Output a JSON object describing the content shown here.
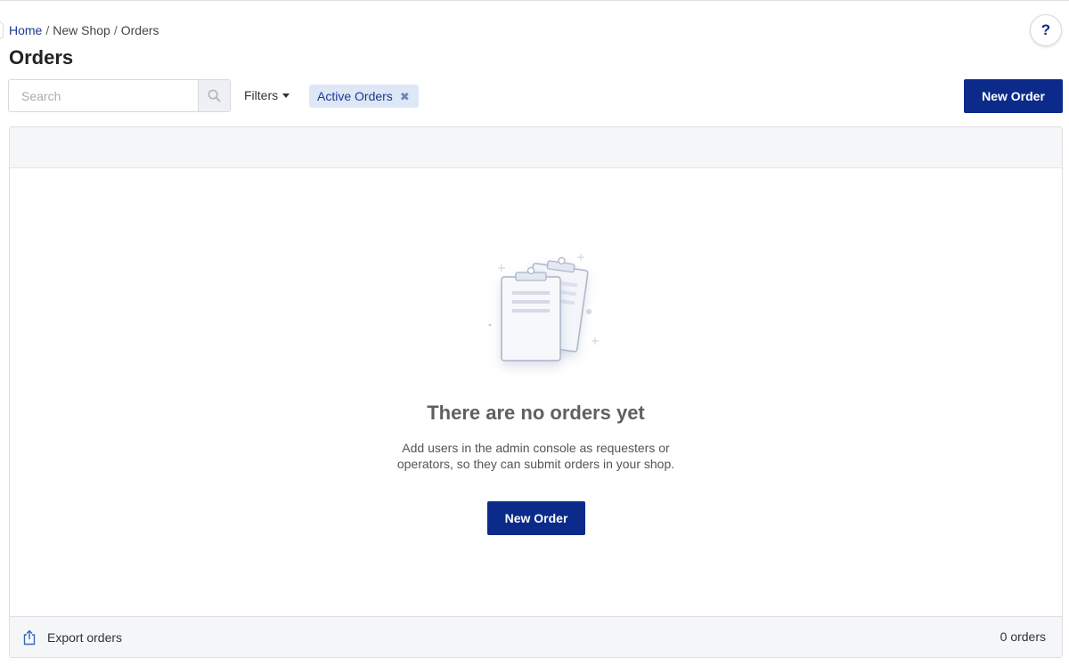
{
  "breadcrumb": {
    "items": [
      {
        "label": "Home"
      },
      {
        "label": "New Shop"
      },
      {
        "label": "Orders"
      }
    ],
    "separator": "/"
  },
  "help": {
    "label": "?"
  },
  "page": {
    "title": "Orders"
  },
  "toolbar": {
    "search_placeholder": "Search",
    "search_value": "",
    "filters_label": "Filters",
    "active_filter": "Active Orders",
    "new_order_label": "New Order"
  },
  "empty_state": {
    "title": "There are no orders yet",
    "description_line1": "Add users in the admin console as requesters or",
    "description_line2": "operators, so they can submit orders in your shop.",
    "button_label": "New Order"
  },
  "footer": {
    "export_label": "Export orders",
    "count_label": "0 orders"
  },
  "icons": {
    "search": "search-icon",
    "filter_caret": "caret-down-icon",
    "chip_remove": "close-icon",
    "export": "share-export-icon",
    "empty": "clipboard-illustration"
  },
  "colors": {
    "primary": "#0b2a8a",
    "link": "#1a3a8f",
    "chip_bg": "#dde7f6"
  }
}
